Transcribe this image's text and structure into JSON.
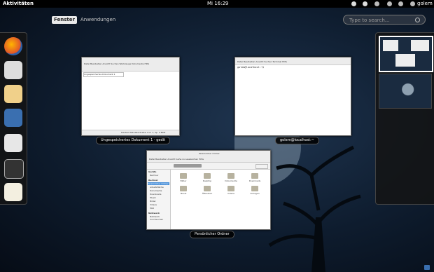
{
  "topbar": {
    "activities": "Aktivitäten",
    "clock": "Mi 16:29",
    "user": "golem"
  },
  "tabs": {
    "windows": "Fenster",
    "applications": "Anwendungen"
  },
  "search": {
    "placeholder": "Type to search..."
  },
  "dash": {
    "apps": [
      "firefox-icon",
      "mail-icon",
      "rhythmbox-icon",
      "photos-icon",
      "files-icon",
      "terminal-icon",
      "text-editor-icon"
    ]
  },
  "windows": {
    "gedit": {
      "caption": "Ungespeichertes Dokument 1 - gedit",
      "menu": "Datei  Bearbeiten  Ansicht  Suchen  Werkzeuge  Dokumente  Hilfe",
      "tab": "Ungespeichertes Dokument 1",
      "status": "Klartext  Tabulatorbreite: 8  Z. 1, Sp. 1  EINF"
    },
    "terminal": {
      "caption": "golem@localhost:~",
      "menu": "Datei  Bearbeiten  Ansicht  Suchen  Terminal  Hilfe",
      "prompt": "golem@localhost:~$"
    },
    "files": {
      "caption": "Persönlicher Ordner",
      "title": "Persönlicher Ordner",
      "menu": "Datei  Bearbeiten  Ansicht  Gehe zu  Lesezeichen  Hilfe",
      "sidebar": {
        "h1": "Geräte",
        "devices": [
          "Rechner"
        ],
        "h2": "Rechner",
        "places": [
          "Persönlicher Ordner",
          "Arbeitsfläche",
          "Dokumente",
          "Downloads",
          "Musik",
          "Bilder",
          "Videos",
          "Müll"
        ],
        "h3": "Netzwerk",
        "network": [
          "Netzwerk durchsuchen"
        ]
      },
      "folders": [
        "Bilder",
        "Desktop",
        "Dokumente",
        "Downloads",
        "Musik",
        "Öffentlich",
        "Videos",
        "Vorlagen"
      ]
    }
  },
  "colors": {
    "background": "#0e1c2e",
    "panel": "#000000"
  }
}
